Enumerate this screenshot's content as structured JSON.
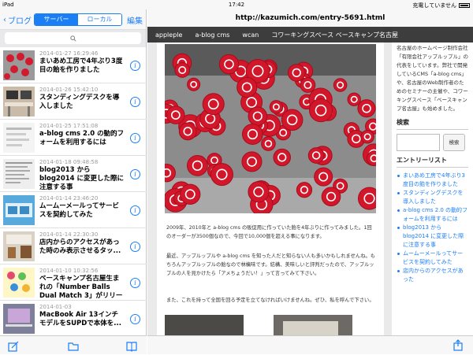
{
  "status": {
    "device": "iPad",
    "time": "17:42",
    "charging": "充電していません"
  },
  "left": {
    "back_label": "ブログ",
    "segments": [
      "サーバー",
      "ローカル"
    ],
    "edit_label": "編集",
    "posts": [
      {
        "date": "2014-01-27 16:29:46",
        "title": "まいあめ工房で4年ぶり3度目の飴を作りました"
      },
      {
        "date": "2014-01-26 15:42:10",
        "title": "スタンディングデスクを導入しました"
      },
      {
        "date": "2014-01-25 17:51:08",
        "title": "a-blog cms 2.0 の動的フォームを利用するには"
      },
      {
        "date": "2014-01-18 09:48:58",
        "title": "blog2013 から blog2014 に変更した際に注意する事"
      },
      {
        "date": "2014-01-14 23:46:20",
        "title": "ムームーメールってサービスを契約してみた"
      },
      {
        "date": "2014-01-14 22:30:30",
        "title": "店内からのアクセスがあった時のみ表示させるタッ..."
      },
      {
        "date": "2014-01-10 10:32:56",
        "title": "ベースキャンプ名古屋生まれの「Number Balls Dual Match 3」がリリースさ..."
      },
      {
        "date": "2014-01-03 ",
        "title": "MacBook Air 13インチモデルをSUPDで本体を..."
      }
    ]
  },
  "right": {
    "url": "http://kazumich.com/entry-5691.html",
    "tabs": [
      "appleple",
      "a-blog cms",
      "wcan",
      "コワーキングスペース ベースキャンプ名古屋"
    ],
    "paragraphs": [
      "2009年、2010年と a-blog cms の販促用に作っていた飴を4年ぶりに作ってみました。1回のオーダーが3500個なので、今回で10,000個を超える事になります。",
      "最近、アップルップルや a-blog cms を知った人だと知らない人も多いかもしれませんね。もちろんアップルップルの飴なので林檎味です。結構、美味しいと評判だったので、アップルップルの人を見かけたら「アメちょうだい！」って言ってみて下さい。",
      "また、これを持って全国を回る予定を立てなければいけませんね。ぜひ、私を呼んで下さい。"
    ],
    "sidebar": {
      "intro_top": "名古屋のホームページ制作会社「有限会社アップルップル」の代表をしています。弊社で開発しているCMS「a-blog cms」や、名古屋のWeb制作者のためのセミナーの主催や、コワーキングスペース「ベースキャンプ名古屋」も始めました。",
      "search_heading": "検索",
      "search_button": "検索",
      "entries_heading": "エントリーリスト",
      "entries": [
        "まいあめ工房で4年ぶり3度目の飴を作りました",
        "スタンディングデスクを導入しました",
        "a-blog cms 2.0 の動的フォームを利用するには",
        "blog2013 から blog2014 に変更した際に注意する事",
        "ムームーメールってサービスを契約してみた",
        "店内からのアクセスがあった"
      ]
    }
  }
}
